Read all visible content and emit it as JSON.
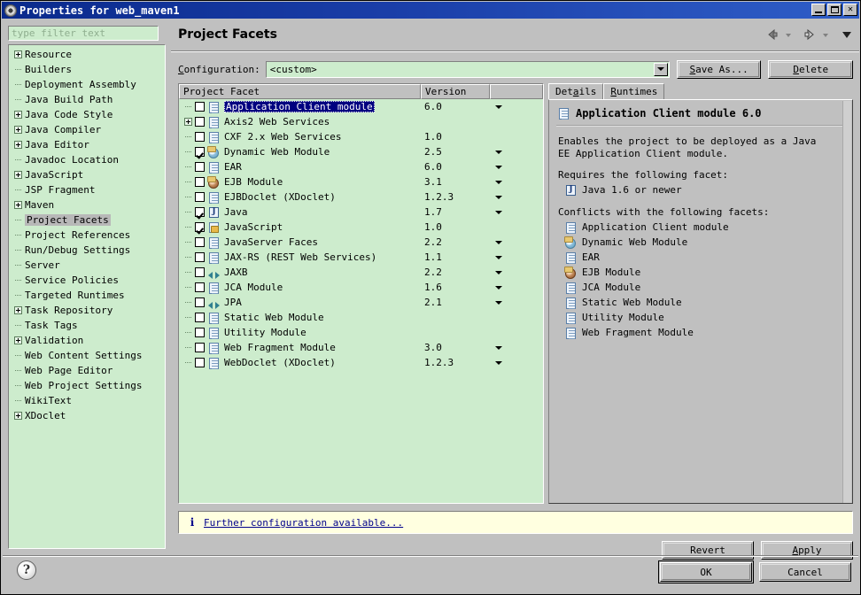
{
  "window": {
    "title": "Properties for web_maven1",
    "icon": "eclipse-gear-icon",
    "minimize_label": "–",
    "maximize_label": "□",
    "close_label": "✕"
  },
  "sidebar": {
    "filter_placeholder": "type filter text",
    "selected": "Project Facets",
    "items": [
      {
        "label": "Resource",
        "expandable": true
      },
      {
        "label": "Builders",
        "expandable": false
      },
      {
        "label": "Deployment Assembly",
        "expandable": false
      },
      {
        "label": "Java Build Path",
        "expandable": false
      },
      {
        "label": "Java Code Style",
        "expandable": true
      },
      {
        "label": "Java Compiler",
        "expandable": true
      },
      {
        "label": "Java Editor",
        "expandable": true
      },
      {
        "label": "Javadoc Location",
        "expandable": false
      },
      {
        "label": "JavaScript",
        "expandable": true
      },
      {
        "label": "JSP Fragment",
        "expandable": false
      },
      {
        "label": "Maven",
        "expandable": true
      },
      {
        "label": "Project Facets",
        "expandable": false,
        "selected": true
      },
      {
        "label": "Project References",
        "expandable": false
      },
      {
        "label": "Run/Debug Settings",
        "expandable": false
      },
      {
        "label": "Server",
        "expandable": false
      },
      {
        "label": "Service Policies",
        "expandable": false
      },
      {
        "label": "Targeted Runtimes",
        "expandable": false
      },
      {
        "label": "Task Repository",
        "expandable": true
      },
      {
        "label": "Task Tags",
        "expandable": false
      },
      {
        "label": "Validation",
        "expandable": true
      },
      {
        "label": "Web Content Settings",
        "expandable": false
      },
      {
        "label": "Web Page Editor",
        "expandable": false
      },
      {
        "label": "Web Project Settings",
        "expandable": false
      },
      {
        "label": "WikiText",
        "expandable": false
      },
      {
        "label": "XDoclet",
        "expandable": true
      }
    ]
  },
  "page": {
    "title": "Project Facets",
    "nav": {
      "back_icon": "back-arrow-icon",
      "back_menu_icon": "chevron-down-icon",
      "forward_icon": "forward-arrow-icon",
      "forward_menu_icon": "chevron-down-icon",
      "view_menu_icon": "view-menu-triangle-icon"
    }
  },
  "configuration": {
    "label": "Configuration:",
    "label_mnemonic": "C",
    "value": "<custom>",
    "save_as_label": "Save As...",
    "save_as_mnemonic": "S",
    "delete_label": "Delete",
    "delete_mnemonic": "D"
  },
  "facet_table": {
    "columns": [
      "Project Facet",
      "Version",
      ""
    ],
    "rows": [
      {
        "name": "Application Client module",
        "version": "6.0",
        "checked": false,
        "expandable": false,
        "icon": "doc-icon",
        "has_version_menu": true,
        "selected": true
      },
      {
        "name": "Axis2 Web Services",
        "version": "",
        "checked": false,
        "expandable": true,
        "icon": "doc-icon",
        "has_version_menu": false,
        "selected": false
      },
      {
        "name": "CXF 2.x Web Services",
        "version": "1.0",
        "checked": false,
        "expandable": false,
        "icon": "doc-icon",
        "has_version_menu": false,
        "selected": false
      },
      {
        "name": "Dynamic Web Module",
        "version": "2.5",
        "checked": true,
        "expandable": false,
        "icon": "globe-icon",
        "has_version_menu": true,
        "selected": false
      },
      {
        "name": "EAR",
        "version": "6.0",
        "checked": false,
        "expandable": false,
        "icon": "doc-icon",
        "has_version_menu": true,
        "selected": false
      },
      {
        "name": "EJB Module",
        "version": "3.1",
        "checked": false,
        "expandable": false,
        "icon": "bean-icon",
        "has_version_menu": true,
        "selected": false
      },
      {
        "name": "EJBDoclet (XDoclet)",
        "version": "1.2.3",
        "checked": false,
        "expandable": false,
        "icon": "doc-icon",
        "has_version_menu": true,
        "selected": false
      },
      {
        "name": "Java",
        "version": "1.7",
        "checked": true,
        "expandable": false,
        "icon": "java-icon",
        "has_version_menu": true,
        "selected": false
      },
      {
        "name": "JavaScript",
        "version": "1.0",
        "checked": true,
        "expandable": false,
        "icon": "javascript-icon",
        "has_version_menu": false,
        "selected": false
      },
      {
        "name": "JavaServer Faces",
        "version": "2.2",
        "checked": false,
        "expandable": false,
        "icon": "doc-icon",
        "has_version_menu": true,
        "selected": false
      },
      {
        "name": "JAX-RS (REST Web Services)",
        "version": "1.1",
        "checked": false,
        "expandable": false,
        "icon": "doc-icon",
        "has_version_menu": true,
        "selected": false
      },
      {
        "name": "JAXB",
        "version": "2.2",
        "checked": false,
        "expandable": false,
        "icon": "transfer-icon",
        "has_version_menu": true,
        "selected": false
      },
      {
        "name": "JCA Module",
        "version": "1.6",
        "checked": false,
        "expandable": false,
        "icon": "doc-icon",
        "has_version_menu": true,
        "selected": false
      },
      {
        "name": "JPA",
        "version": "2.1",
        "checked": false,
        "expandable": false,
        "icon": "transfer-icon",
        "has_version_menu": true,
        "selected": false
      },
      {
        "name": "Static Web Module",
        "version": "",
        "checked": false,
        "expandable": false,
        "icon": "doc-icon",
        "has_version_menu": false,
        "selected": false
      },
      {
        "name": "Utility Module",
        "version": "",
        "checked": false,
        "expandable": false,
        "icon": "doc-icon",
        "has_version_menu": false,
        "selected": false
      },
      {
        "name": "Web Fragment Module",
        "version": "3.0",
        "checked": false,
        "expandable": false,
        "icon": "doc-icon",
        "has_version_menu": true,
        "selected": false
      },
      {
        "name": "WebDoclet (XDoclet)",
        "version": "1.2.3",
        "checked": false,
        "expandable": false,
        "icon": "doc-icon",
        "has_version_menu": true,
        "selected": false
      }
    ]
  },
  "details": {
    "tabs": [
      {
        "label": "Details",
        "mnemonic": "a",
        "active": true
      },
      {
        "label": "Runtimes",
        "mnemonic": "R",
        "active": false
      }
    ],
    "heading": "Application Client module 6.0",
    "heading_icon": "doc-icon",
    "description": "Enables the project to be deployed as a Java EE Application Client module.",
    "requires_label": "Requires the following facet:",
    "requires": [
      {
        "label": "Java 1.6 or newer",
        "icon": "java-icon"
      }
    ],
    "conflicts_label": "Conflicts with the following facets:",
    "conflicts": [
      {
        "label": "Application Client module",
        "icon": "doc-icon"
      },
      {
        "label": "Dynamic Web Module",
        "icon": "globe-icon"
      },
      {
        "label": "EAR",
        "icon": "doc-icon"
      },
      {
        "label": "EJB Module",
        "icon": "bean-icon"
      },
      {
        "label": "JCA Module",
        "icon": "doc-icon"
      },
      {
        "label": "Static Web Module",
        "icon": "doc-icon"
      },
      {
        "label": "Utility Module",
        "icon": "doc-icon"
      },
      {
        "label": "Web Fragment Module",
        "icon": "doc-icon"
      }
    ]
  },
  "infobar": {
    "icon": "info-icon",
    "message": "Further configuration available..."
  },
  "buttons": {
    "revert": "Revert",
    "apply": "Apply",
    "apply_mnemonic": "A",
    "ok": "OK",
    "cancel": "Cancel",
    "help_icon": "question-mark-icon"
  },
  "colors": {
    "title_bar": "#0a2a8c",
    "list_background": "#cdeccd",
    "panel_background": "#c0c0c0",
    "selection": "#000080",
    "info_background": "#ffffe0",
    "link": "#00008b"
  }
}
